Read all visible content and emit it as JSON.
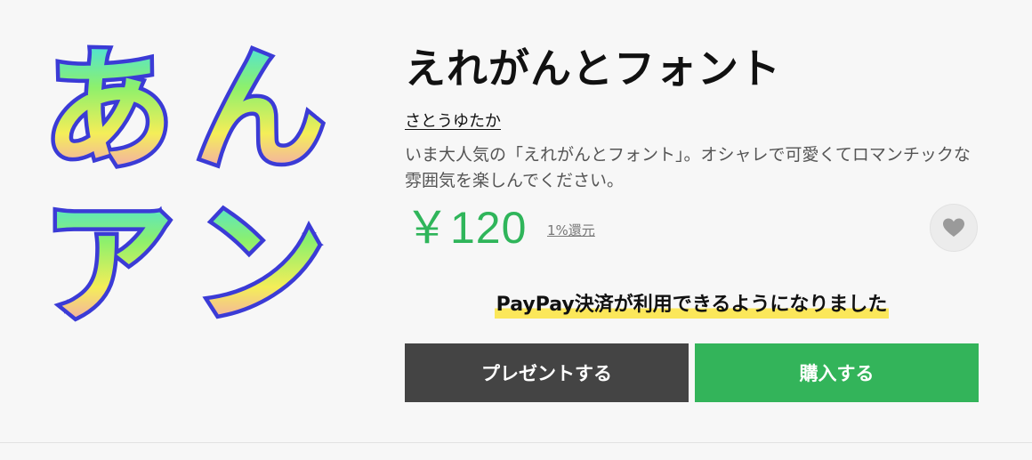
{
  "product": {
    "title": "えれがんとフォント",
    "author": "さとうゆたか",
    "description": "いま大人気の「えれがんとフォント」。オシャレで可愛くてロマンチックな雰囲気を楽しんでください。",
    "price": "￥120",
    "cashback": "1%還元",
    "preview_chars": [
      "あ",
      "ん",
      "ア",
      "ン"
    ]
  },
  "favorite": {
    "icon": "heart-icon"
  },
  "notice": {
    "paypay": "PayPay決済が利用できるようになりました"
  },
  "buttons": {
    "gift_label": "プレゼントする",
    "buy_label": "購入する"
  },
  "colors": {
    "price": "#2fb55a",
    "buy_button": "#33b45a",
    "gift_button": "#444444",
    "highlight": "#fbe75a",
    "glyph_outline": "#3b3bd6"
  }
}
